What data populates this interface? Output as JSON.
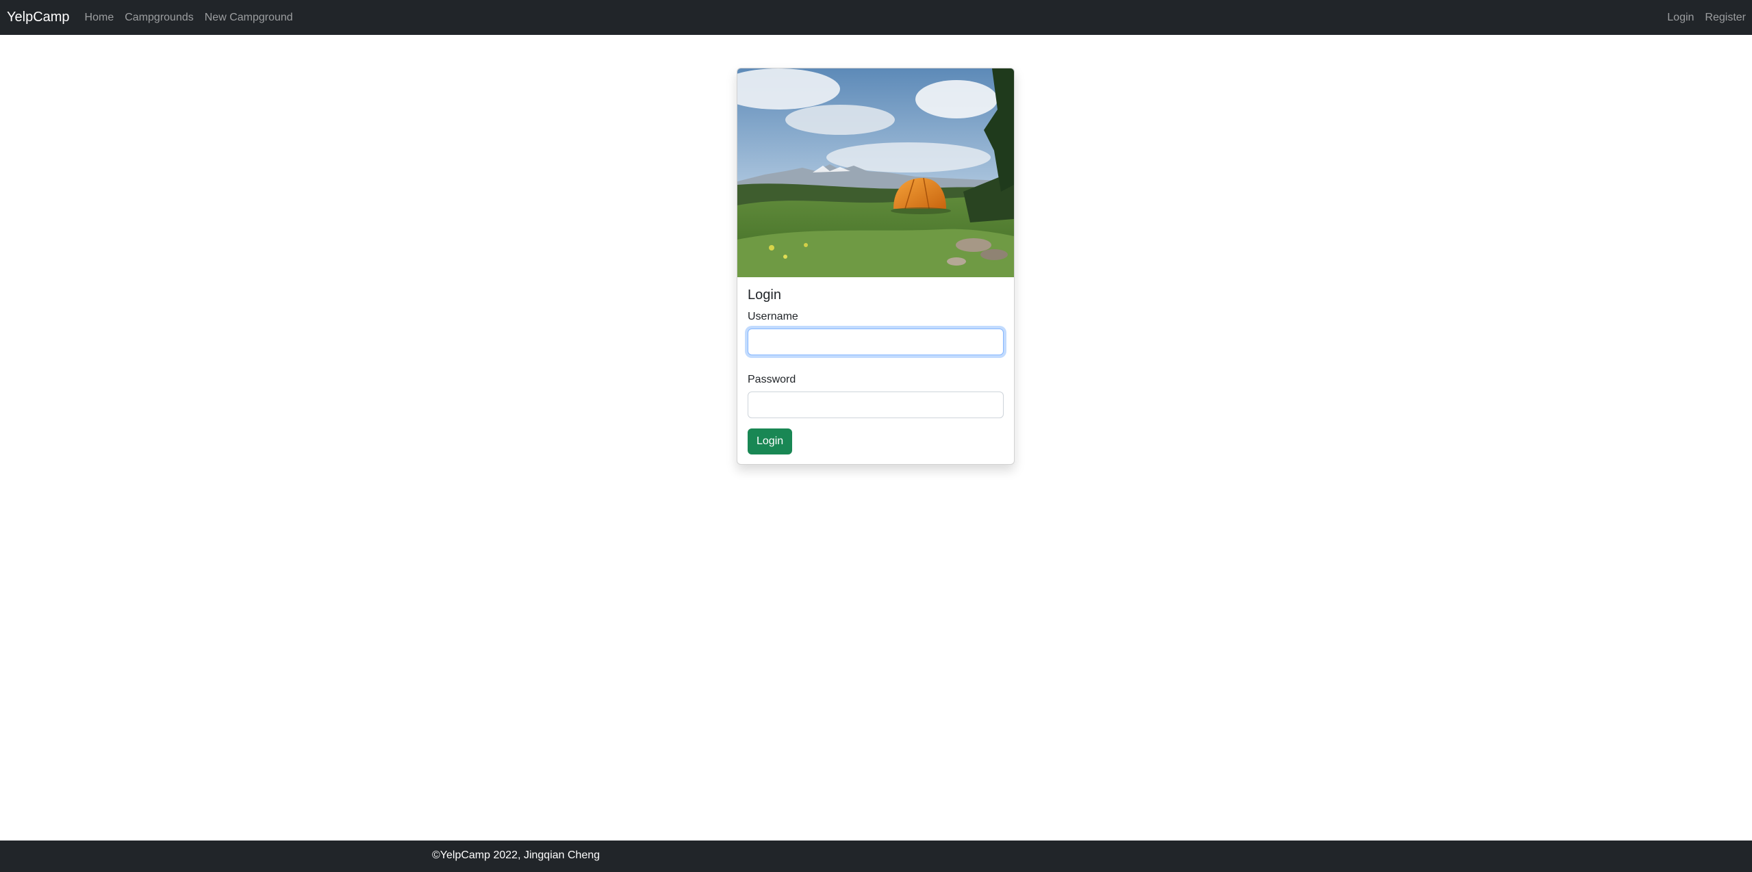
{
  "navbar": {
    "brand": "YelpCamp",
    "left_links": [
      "Home",
      "Campgrounds",
      "New Campground"
    ],
    "right_links": [
      "Login",
      "Register"
    ]
  },
  "login_card": {
    "image_alt": "Orange tent on a grassy hill with mountains",
    "title": "Login",
    "username_label": "Username",
    "username_value": "",
    "password_label": "Password",
    "password_value": "",
    "submit_label": "Login"
  },
  "footer": {
    "text": "©YelpCamp 2022, Jingqian Cheng"
  },
  "colors": {
    "navbar_bg": "#212529",
    "button_bg": "#198754",
    "focus_ring": "#86b7fe"
  }
}
